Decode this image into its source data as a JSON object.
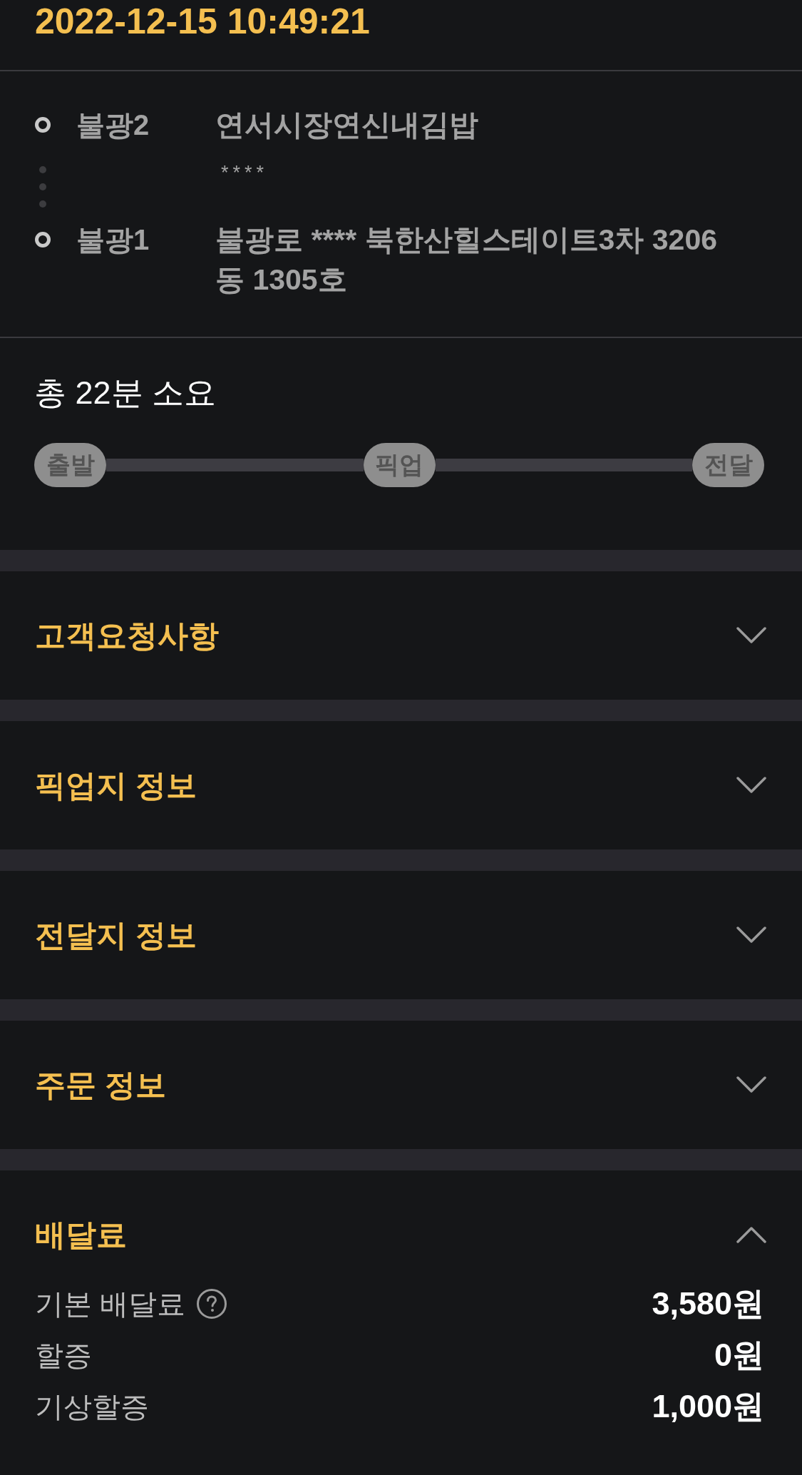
{
  "datetime": "2022-12-15 10:49:21",
  "route": {
    "stops": [
      {
        "label": "불광2",
        "address": "연서시장연신내김밥",
        "detail": "****"
      },
      {
        "label": "불광1",
        "address": "불광로 **** 북한산힐스테이트3차 3206동 1305호"
      }
    ]
  },
  "duration": {
    "text": "총 22분 소요",
    "steps": [
      "출발",
      "픽업",
      "전달"
    ]
  },
  "sections": [
    {
      "title": "고객요청사항",
      "expanded": false
    },
    {
      "title": "픽업지 정보",
      "expanded": false
    },
    {
      "title": "전달지 정보",
      "expanded": false
    },
    {
      "title": "주문 정보",
      "expanded": false
    },
    {
      "title": "배달료",
      "expanded": true,
      "rows": [
        {
          "label": "기본 배달료",
          "help": true,
          "value": "3,580원"
        },
        {
          "label": "할증",
          "help": false,
          "value": "0원"
        },
        {
          "label": "기상할증",
          "help": false,
          "value": "1,000원"
        }
      ]
    }
  ]
}
